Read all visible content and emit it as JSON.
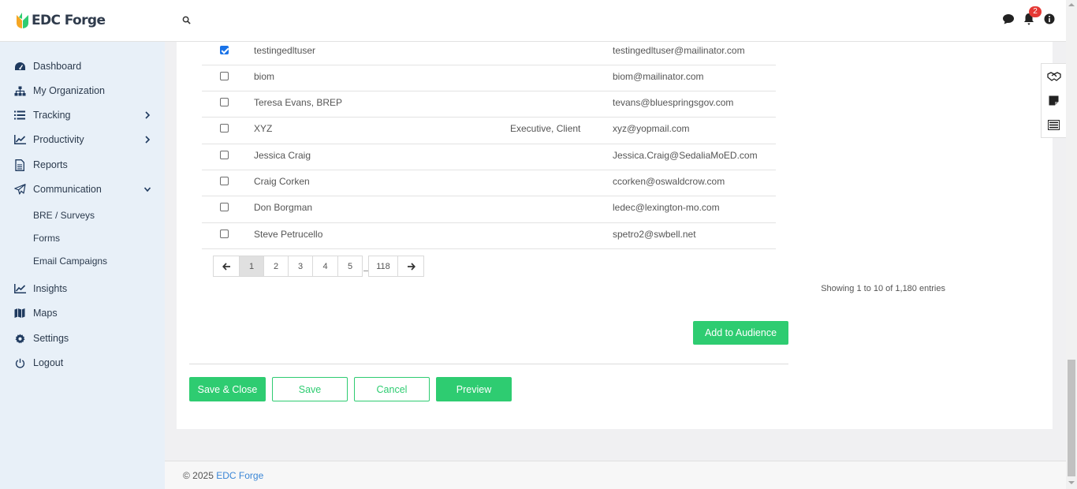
{
  "brand": {
    "name": "EDC Forge"
  },
  "header": {
    "notification_count": "2"
  },
  "sidebar": {
    "items": [
      {
        "label": "Dashboard",
        "icon": "dashboard-icon"
      },
      {
        "label": "My Organization",
        "icon": "org-chart-icon"
      },
      {
        "label": "Tracking",
        "icon": "list-icon",
        "chevron": "right"
      },
      {
        "label": "Productivity",
        "icon": "line-chart-icon",
        "chevron": "right"
      },
      {
        "label": "Reports",
        "icon": "document-icon"
      },
      {
        "label": "Communication",
        "icon": "paper-plane-icon",
        "chevron": "down"
      },
      {
        "label": "Insights",
        "icon": "line-chart-icon"
      },
      {
        "label": "Maps",
        "icon": "map-icon"
      },
      {
        "label": "Settings",
        "icon": "gear-icon"
      },
      {
        "label": "Logout",
        "icon": "power-icon"
      }
    ],
    "sub_items": [
      "BRE / Surveys",
      "Forms",
      "Email Campaigns"
    ]
  },
  "table": {
    "rows": [
      {
        "checked": true,
        "name": "testingedltuser",
        "role": "",
        "email": "testingedltuser@mailinator.com"
      },
      {
        "checked": false,
        "name": "biom",
        "role": "",
        "email": "biom@mailinator.com"
      },
      {
        "checked": false,
        "name": "Teresa Evans, BREP",
        "role": "",
        "email": "tevans@bluespringsgov.com"
      },
      {
        "checked": false,
        "name": "XYZ",
        "role": "Executive, Client",
        "email": "xyz@yopmail.com"
      },
      {
        "checked": false,
        "name": "Jessica Craig",
        "role": "",
        "email": "Jessica.Craig@SedaliaMoED.com"
      },
      {
        "checked": false,
        "name": "Craig Corken",
        "role": "",
        "email": "ccorken@oswaldcrow.com"
      },
      {
        "checked": false,
        "name": "Don Borgman",
        "role": "",
        "email": "ledec@lexington-mo.com"
      },
      {
        "checked": false,
        "name": "Steve Petrucello",
        "role": "",
        "email": "spetro2@swbell.net"
      }
    ]
  },
  "pagination": {
    "prev_icon": "arrow-left-icon",
    "next_icon": "arrow-right-icon",
    "pages": [
      "1",
      "2",
      "3",
      "4",
      "5"
    ],
    "last_page": "118",
    "current": "1",
    "showing": "Showing 1 to 10 of 1,180 entries"
  },
  "actions": {
    "add_to_audience": "Add to Audience",
    "save_close": "Save & Close",
    "save": "Save",
    "cancel": "Cancel",
    "preview": "Preview"
  },
  "footer": {
    "copyright": "© 2025",
    "link": "EDC Forge"
  },
  "colors": {
    "accent": "#2ecc71",
    "sidebar_bg": "#e8f0f8",
    "link": "#3a86d6",
    "badge": "#e53935"
  }
}
